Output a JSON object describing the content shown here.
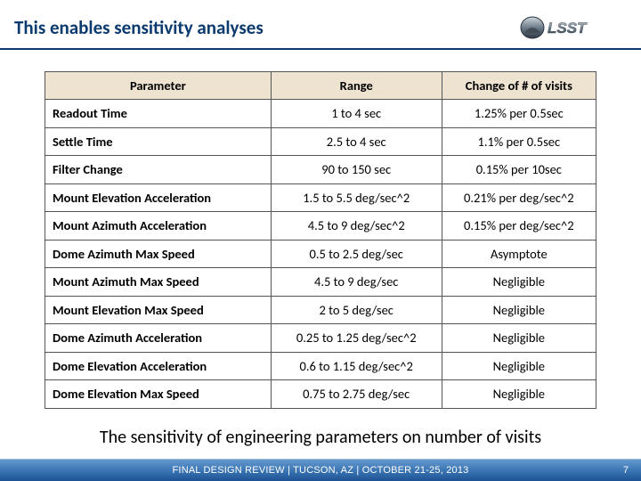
{
  "header": {
    "title": "This enables sensitivity analyses",
    "logo_text": "LSST"
  },
  "table": {
    "headers": {
      "parameter": "Parameter",
      "range": "Range",
      "change": "Change of # of visits"
    },
    "rows": [
      {
        "parameter": "Readout Time",
        "range": "1 to 4 sec",
        "change": "1.25% per 0.5sec"
      },
      {
        "parameter": "Settle Time",
        "range": "2.5 to 4 sec",
        "change": "1.1% per 0.5sec"
      },
      {
        "parameter": "Filter Change",
        "range": "90 to 150 sec",
        "change": "0.15% per 10sec"
      },
      {
        "parameter": "Mount Elevation Acceleration",
        "range": "1.5 to 5.5 deg/sec^2",
        "change": "0.21% per deg/sec^2"
      },
      {
        "parameter": "Mount Azimuth Acceleration",
        "range": "4.5 to 9 deg/sec^2",
        "change": "0.15% per deg/sec^2"
      },
      {
        "parameter": "Dome Azimuth Max Speed",
        "range": "0.5 to 2.5 deg/sec",
        "change": "Asymptote"
      },
      {
        "parameter": "Mount Azimuth Max Speed",
        "range": "4.5 to 9 deg/sec",
        "change": "Negligible"
      },
      {
        "parameter": "Mount Elevation Max Speed",
        "range": "2 to 5 deg/sec",
        "change": "Negligible"
      },
      {
        "parameter": "Dome Azimuth Acceleration",
        "range": "0.25 to 1.25 deg/sec^2",
        "change": "Negligible"
      },
      {
        "parameter": "Dome Elevation Acceleration",
        "range": "0.6 to 1.15 deg/sec^2",
        "change": "Negligible"
      },
      {
        "parameter": "Dome Elevation Max Speed",
        "range": "0.75 to 2.75 deg/sec",
        "change": "Negligible"
      }
    ]
  },
  "caption": "The sensitivity of engineering parameters on number of visits",
  "footer": {
    "text": "FINAL DESIGN REVIEW | TUCSON, AZ | OCTOBER 21-25, 2013",
    "page": "7"
  }
}
